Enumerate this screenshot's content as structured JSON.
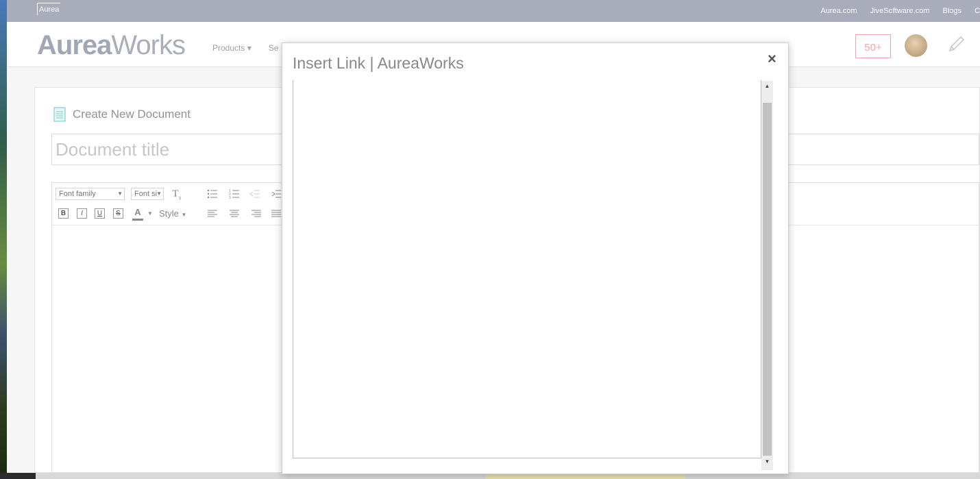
{
  "topbar": {
    "logo": "Aurea",
    "links": [
      "Aurea.com",
      "JiveSoftware.com",
      "Blogs",
      "C"
    ]
  },
  "header": {
    "brand_bold": "Aurea",
    "brand_light": "Works",
    "nav": [
      "Products ▾",
      "Se"
    ],
    "notifications": "50+"
  },
  "document": {
    "heading": "Create New Document",
    "title_placeholder": "Document title"
  },
  "toolbar": {
    "font_family": "Font family",
    "font_size": "Font si",
    "style": "Style"
  },
  "modal": {
    "title": "Insert Link | AureaWorks",
    "close": "×"
  }
}
